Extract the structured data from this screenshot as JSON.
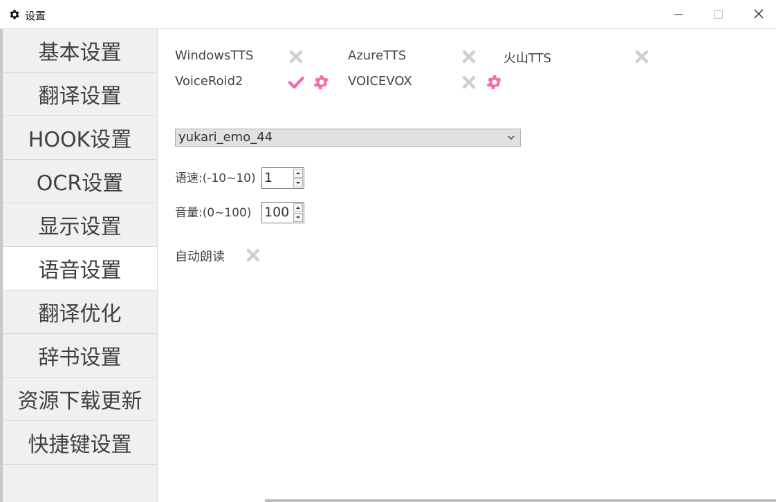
{
  "window": {
    "title": "设置",
    "icon": "gear-icon",
    "controls": [
      "minimize-icon",
      "maximize-icon",
      "close-icon"
    ]
  },
  "sidebar": {
    "items": [
      {
        "label": "基本设置",
        "active": false
      },
      {
        "label": "翻译设置",
        "active": false
      },
      {
        "label": "HOOK设置",
        "active": false
      },
      {
        "label": "OCR设置",
        "active": false
      },
      {
        "label": "显示设置",
        "active": false
      },
      {
        "label": "语音设置",
        "active": true
      },
      {
        "label": "翻译优化",
        "active": false
      },
      {
        "label": "辞书设置",
        "active": false
      },
      {
        "label": "资源下载更新",
        "active": false
      },
      {
        "label": "快捷键设置",
        "active": false
      }
    ]
  },
  "engines": [
    {
      "label": "WindowsTTS",
      "enabled": false,
      "toggle_icon": "cross-icon"
    },
    {
      "label": "AzureTTS",
      "enabled": false,
      "toggle_icon": "cross-icon"
    },
    {
      "label": "火山TTS",
      "enabled": false,
      "toggle_icon": "cross-icon"
    },
    {
      "label": "VoiceRoid2",
      "enabled": true,
      "toggle_icon": "check-icon",
      "settings_icon": "gear-icon"
    },
    {
      "label": "VOICEVOX",
      "enabled": false,
      "toggle_icon": "cross-icon",
      "settings_icon": "gear-icon"
    }
  ],
  "voice_select": {
    "value": "yukari_emo_44",
    "arrow_icon": "chevron-down-icon"
  },
  "speed": {
    "label": "语速:(-10~10)",
    "value": "1"
  },
  "volume": {
    "label": "音量:(0~100)",
    "value": "100"
  },
  "auto_read": {
    "label": "自动朗读",
    "enabled": false,
    "toggle_icon": "cross-icon"
  },
  "colors": {
    "accent": "#ef6fae",
    "disabled": "#d0d0d0",
    "sidebar_bg": "#f0f0f0",
    "select_bg": "#e1e1e1"
  }
}
